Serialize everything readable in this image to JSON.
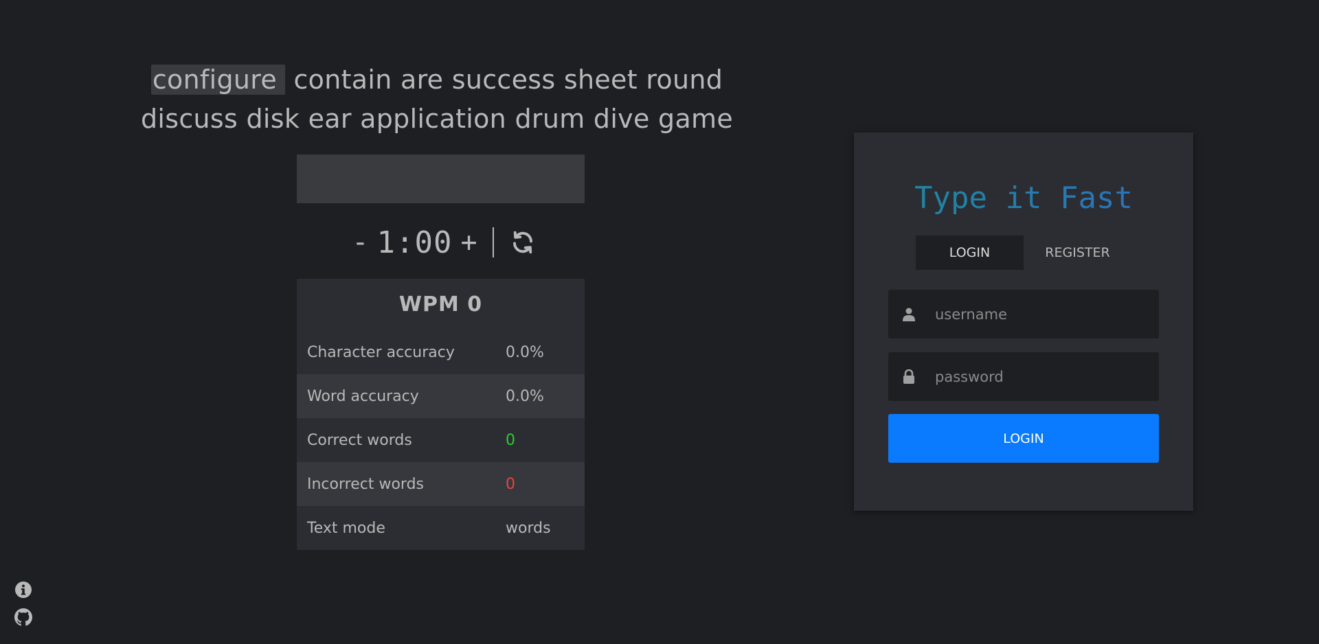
{
  "prompt": {
    "words": [
      "configure",
      "contain",
      "are",
      "success",
      "sheet",
      "round",
      "discuss",
      "disk",
      "ear",
      "application",
      "drum",
      "dive",
      "game"
    ],
    "current_index": 0
  },
  "typing_input": {
    "value": ""
  },
  "timer": {
    "decrement_label": "-",
    "value": "1:00",
    "increment_label": "+",
    "refresh_icon": "refresh-icon"
  },
  "stats": {
    "header": "WPM 0",
    "rows": [
      {
        "label": "Character accuracy",
        "value": "0.0%"
      },
      {
        "label": "Word accuracy",
        "value": "0.0%"
      },
      {
        "label": "Correct words",
        "value": "0"
      },
      {
        "label": "Incorrect words",
        "value": "0"
      },
      {
        "label": "Text mode",
        "value": "words"
      }
    ]
  },
  "auth": {
    "title": "Type it Fast",
    "tabs": [
      {
        "label": "LOGIN",
        "active": true
      },
      {
        "label": "REGISTER",
        "active": false
      }
    ],
    "username_placeholder": "username",
    "password_placeholder": "password",
    "submit_label": "LOGIN"
  },
  "corner_icons": [
    "info-icon",
    "github-icon"
  ],
  "colors": {
    "background": "#1e1f23",
    "panel": "#2c2d33",
    "accent_button": "#0a7bff",
    "correct": "#2ecc2e",
    "incorrect": "#e6463c",
    "title_gradient_start": "#1e8a9a",
    "title_gradient_end": "#2c6fc0"
  }
}
